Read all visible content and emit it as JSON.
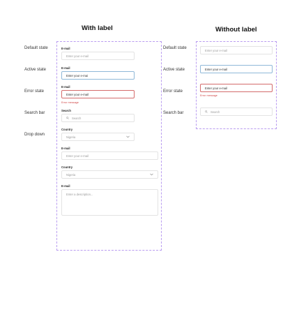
{
  "headers": {
    "with_label": "With label",
    "without_label": "Without label"
  },
  "left_states": {
    "default": "Default state",
    "active": "Active state",
    "error": "Error state",
    "search": "Search bar",
    "dropdown": "Drop down"
  },
  "right_states": {
    "default": "Default state",
    "active": "Active state",
    "error": "Error state",
    "search": "Search bar"
  },
  "with_label": {
    "email_default": {
      "label": "E-mail",
      "placeholder": "Enter your e-mail"
    },
    "email_active": {
      "label": "E-mail",
      "value": "Enter your e-mai"
    },
    "email_error": {
      "label": "E-mail",
      "value": "Enter your e-mail",
      "error": "Error message"
    },
    "search": {
      "label": "Search",
      "placeholder": "Search"
    },
    "country_dropdown": {
      "label": "Country",
      "value": "Nigeria"
    },
    "email_wide": {
      "label": "E-mail",
      "placeholder": "Enter your e-mail"
    },
    "country_wide": {
      "label": "Country",
      "value": "Nigeria"
    },
    "description": {
      "label": "E-mail",
      "placeholder": "Enter a description..."
    }
  },
  "without_label": {
    "email_default": {
      "placeholder": "Enter your e-mail"
    },
    "email_active": {
      "value": "Enter your e-mail"
    },
    "email_error": {
      "value": "Enter your e-mail",
      "error": "Error message"
    },
    "search": {
      "placeholder": "Search"
    }
  },
  "colors": {
    "frame_border": "#b99cf0",
    "active_border": "#8fb8d8",
    "error": "#d14848"
  },
  "icons": {
    "search": "search-icon",
    "dropdown": "chevron-down-icon"
  }
}
